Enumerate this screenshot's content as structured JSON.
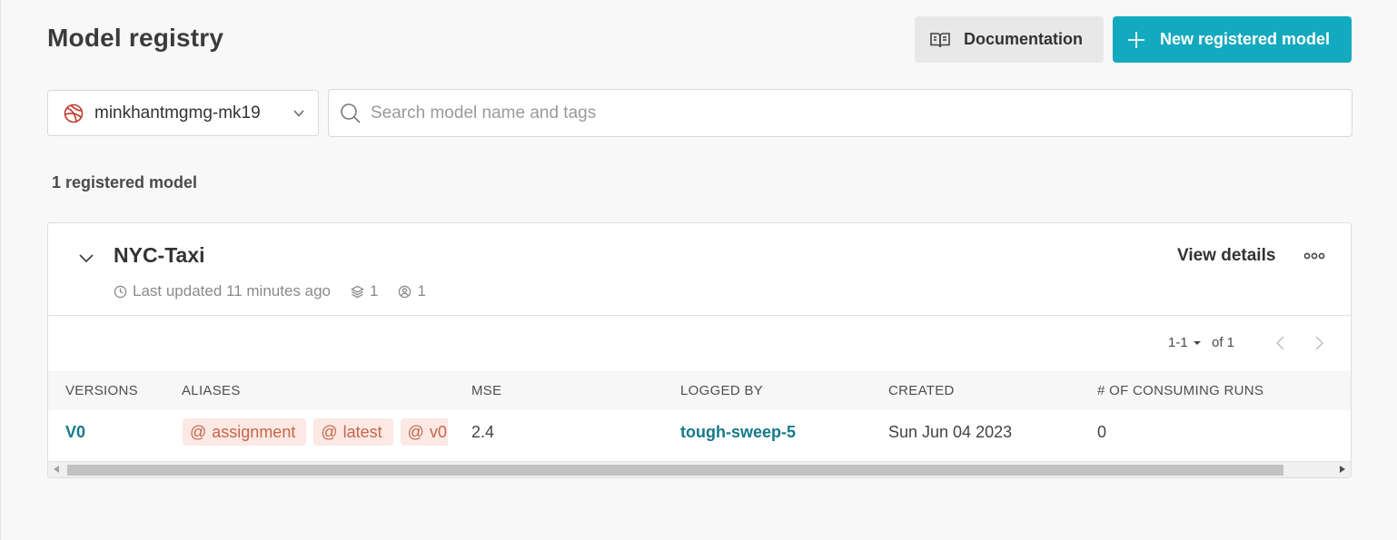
{
  "header": {
    "title": "Model registry",
    "doc_button": "Documentation",
    "new_button": "New registered model"
  },
  "filters": {
    "entity": "minkhantmgmg-mk19",
    "entity_icon": "org-globe-icon",
    "search_placeholder": "Search model name and tags"
  },
  "summary": {
    "count_label": "1 registered model"
  },
  "model": {
    "name": "NYC-Taxi",
    "last_updated": "Last updated 11 minutes ago",
    "versions_count": "1",
    "members_count": "1",
    "view_details": "View details",
    "pagination": {
      "range": "1-1",
      "of": "of 1"
    },
    "columns": [
      "VERSIONS",
      "ALIASES",
      "MSE",
      "LOGGED BY",
      "CREATED",
      "# OF CONSUMING RUNS"
    ],
    "rows": [
      {
        "version": "V0",
        "aliases": [
          "assignment",
          "latest",
          "v0"
        ],
        "mse": "2.4",
        "logged_by": "tough-sweep-5",
        "created": "Sun Jun 04 2023",
        "consuming_runs": "0"
      }
    ]
  },
  "colors": {
    "accent": "#13a9be",
    "link": "#16798a",
    "alias_bg": "#fce9e3",
    "alias_text": "#c6654e"
  }
}
